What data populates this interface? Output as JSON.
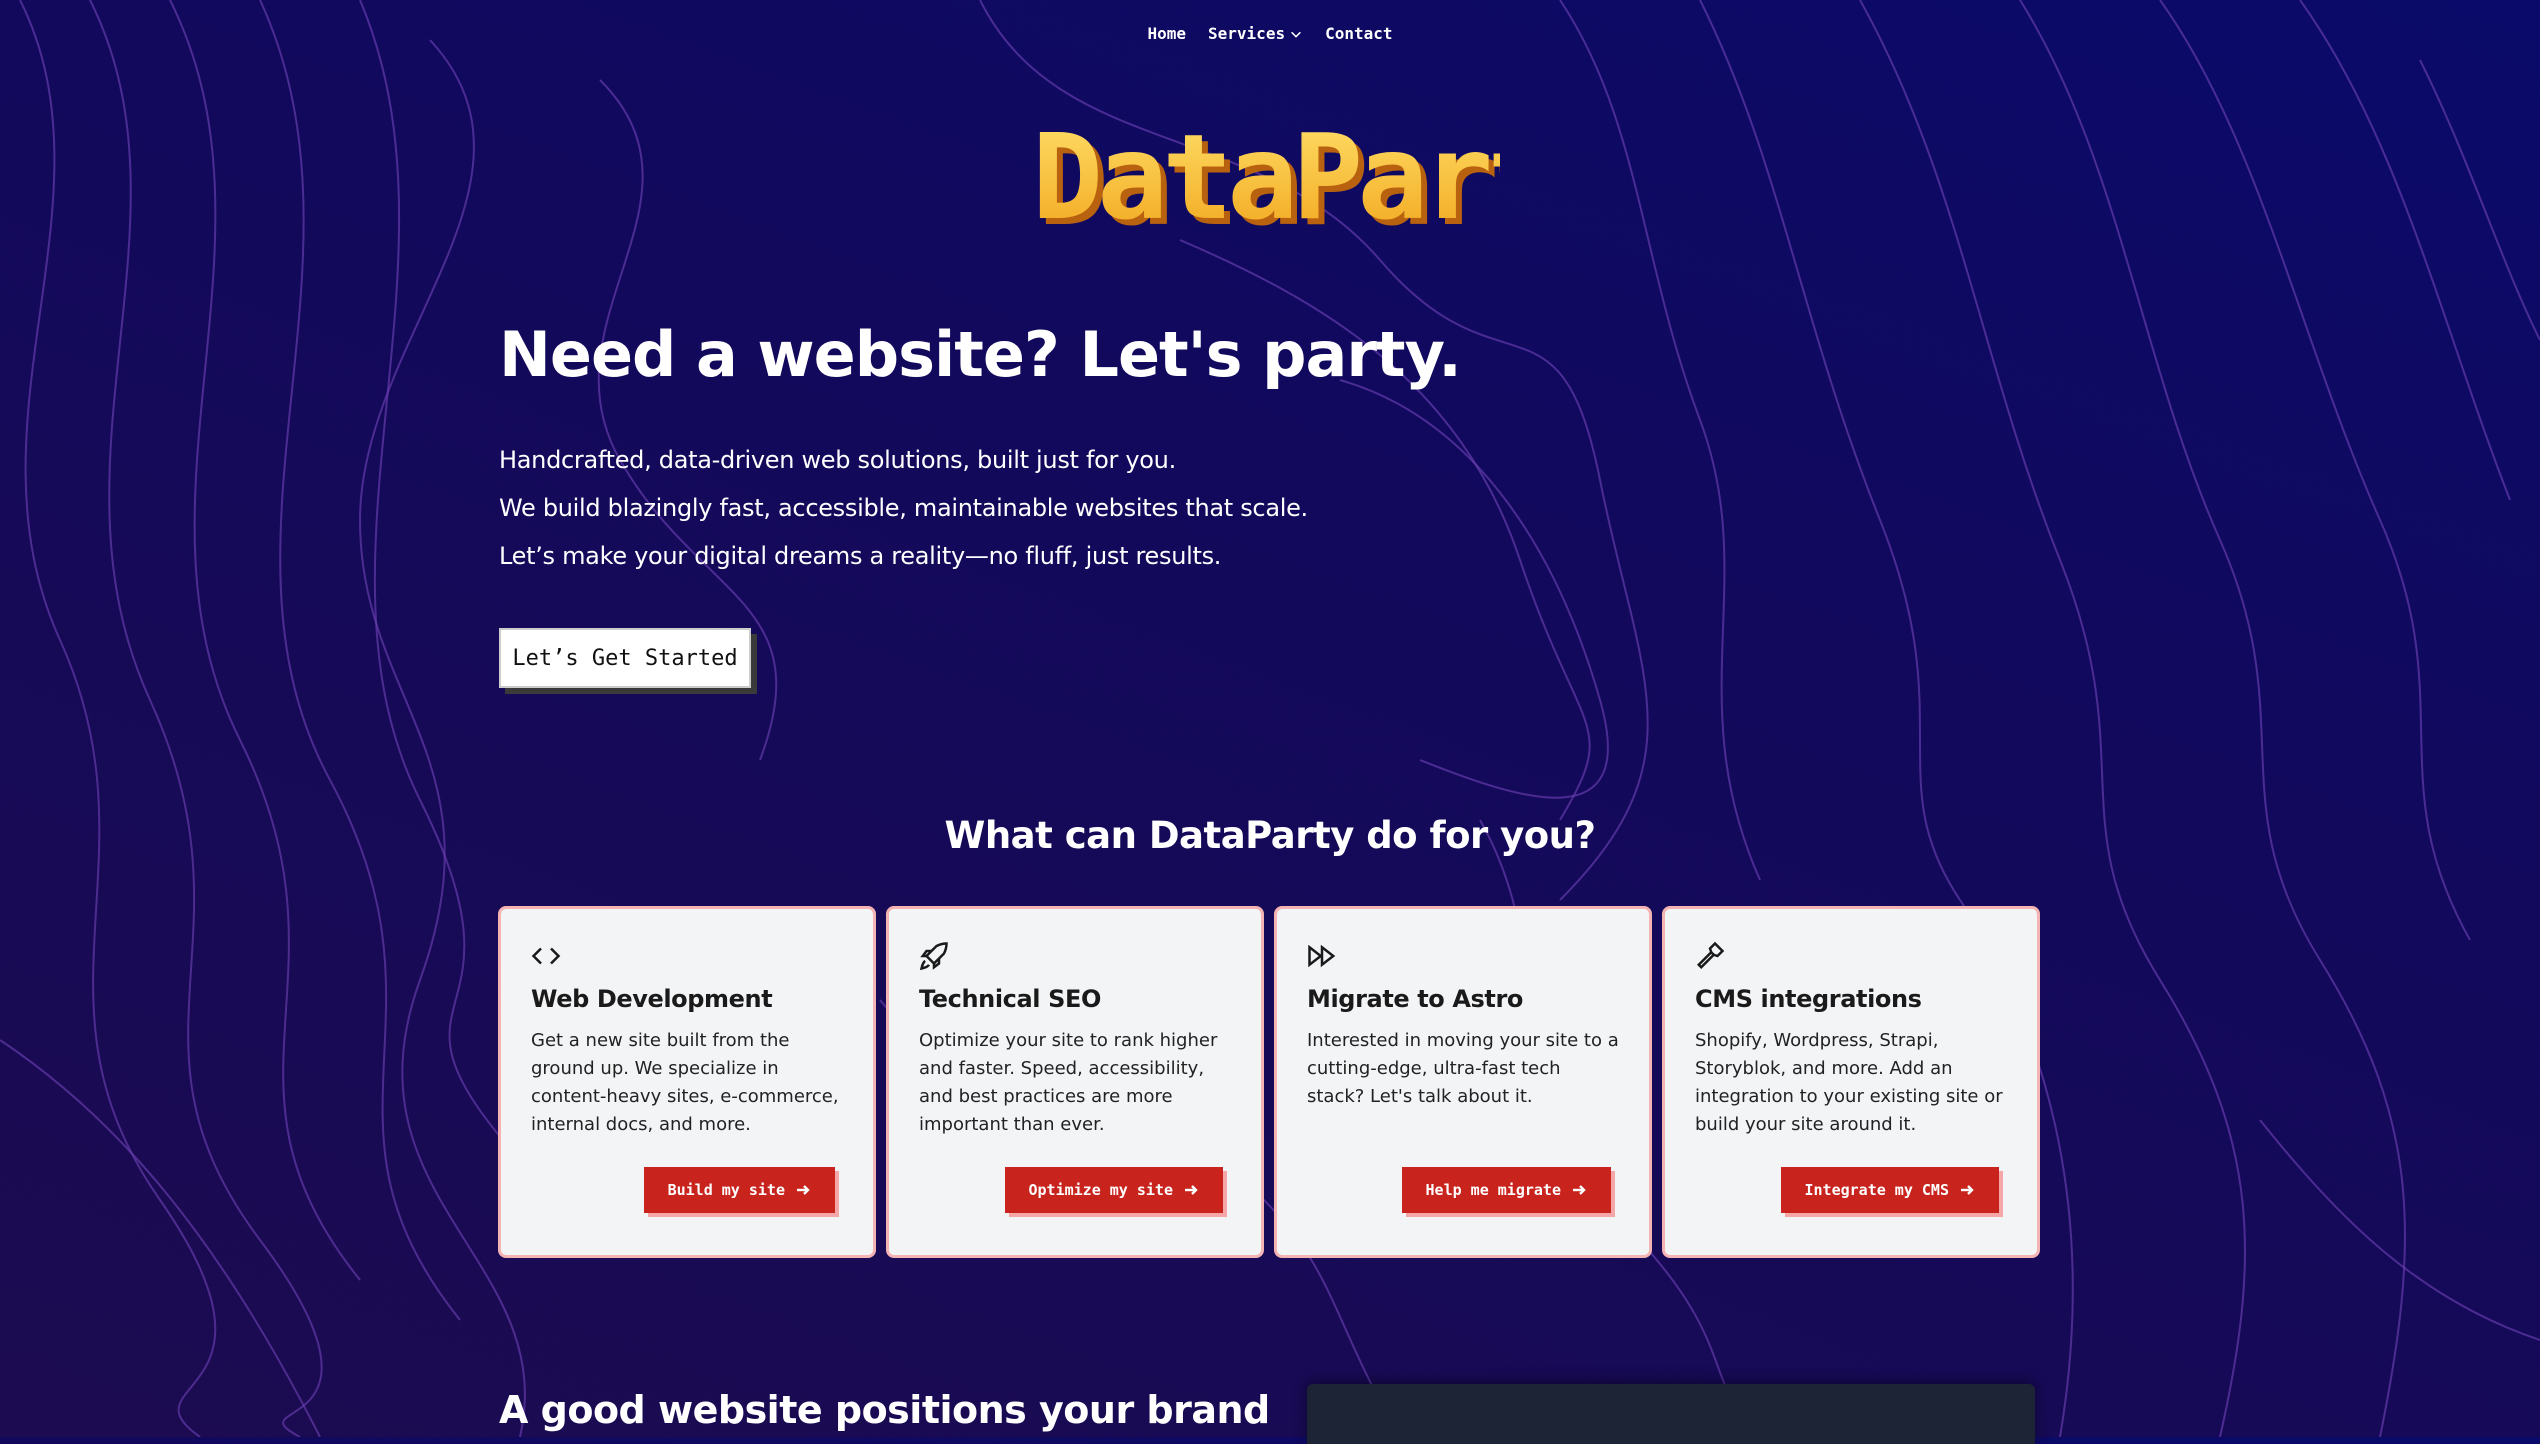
{
  "nav": {
    "home": "Home",
    "services": "Services",
    "contact": "Contact"
  },
  "logo": {
    "text": "DataParty"
  },
  "hero": {
    "title": "Need a website? Let's party.",
    "line1": "Handcrafted, data-driven web solutions, built just for you.",
    "line2": "We build blazingly fast, accessible, maintainable websites that scale.",
    "line3": "Let’s make your digital dreams a reality—no fluff, just results.",
    "cta": "Let’s Get Started"
  },
  "services": {
    "title": "What can DataParty do for you?",
    "cards": [
      {
        "icon": "code-icon",
        "title": "Web Development",
        "body": "Get a new site built from the ground up. We specialize in content-heavy sites, e-commerce, internal docs, and more.",
        "button": "Build my site"
      },
      {
        "icon": "rocket-icon",
        "title": "Technical SEO",
        "body": "Optimize your site to rank higher and faster. Speed, accessibility, and best practices are more important than ever.",
        "button": "Optimize my site"
      },
      {
        "icon": "fast-forward-icon",
        "title": "Migrate to Astro",
        "body": "Interested in moving your site to a cutting-edge, ultra-fast tech stack? Let's talk about it.",
        "button": "Help me migrate"
      },
      {
        "icon": "hammer-icon",
        "title": "CMS integrations",
        "body": "Shopify, Wordpress, Strapi, Storyblok, and more. Add an integration to your existing site or build your site around it.",
        "button": "Integrate my CMS"
      }
    ]
  },
  "brand": {
    "title": "A good website positions your brand"
  },
  "colors": {
    "background": "#12095c",
    "accent_button": "#c8231d",
    "logo_gold": "#f5c232",
    "card_border": "#f4b4b4"
  }
}
